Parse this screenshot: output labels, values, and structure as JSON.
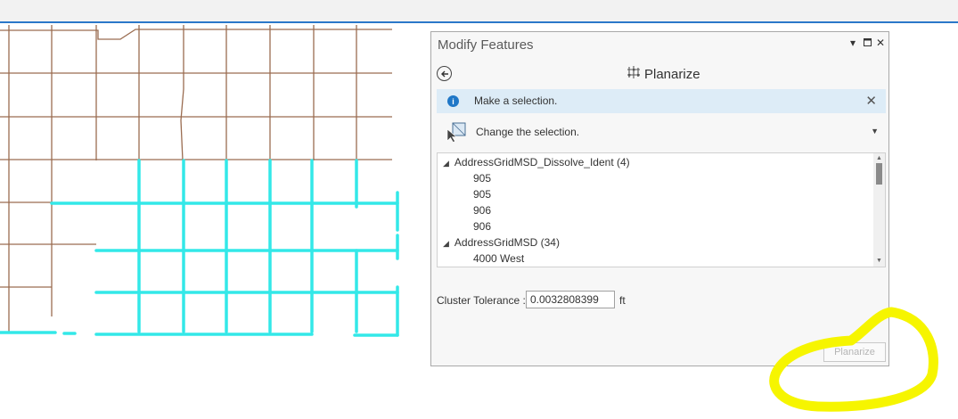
{
  "pane": {
    "title": "Modify Features",
    "controls": {
      "pin_icon": "chevron-down-icon",
      "maximize_icon": "maximize-icon",
      "close_icon": "close-icon"
    }
  },
  "tool": {
    "back_icon": "back-arrow-icon",
    "icon": "planarize-icon",
    "name": "Planarize"
  },
  "message": {
    "icon": "info-icon",
    "text": "Make a selection."
  },
  "selection": {
    "icon": "select-by-rectangle-icon",
    "label": "Change the selection."
  },
  "tree": [
    {
      "kind": "layer",
      "label": "AddressGridMSD_Dissolve_Ident (4)",
      "expanded": true
    },
    {
      "kind": "feature",
      "label": "905"
    },
    {
      "kind": "feature",
      "label": "905"
    },
    {
      "kind": "feature",
      "label": "906"
    },
    {
      "kind": "feature",
      "label": "906"
    },
    {
      "kind": "layer",
      "label": "AddressGridMSD (34)",
      "expanded": true
    },
    {
      "kind": "feature",
      "label": "4000 West"
    }
  ],
  "tolerance": {
    "label": "Cluster Tolerance :",
    "value": "0.0032808399",
    "unit": "ft"
  },
  "run_button": {
    "label": "Planarize",
    "enabled": false
  },
  "colors": {
    "accent": "#2b78c9",
    "road": "#9a6c50",
    "selected_road": "#33e8e8",
    "highlight": "#f6f500",
    "info": "#1f77c7"
  }
}
